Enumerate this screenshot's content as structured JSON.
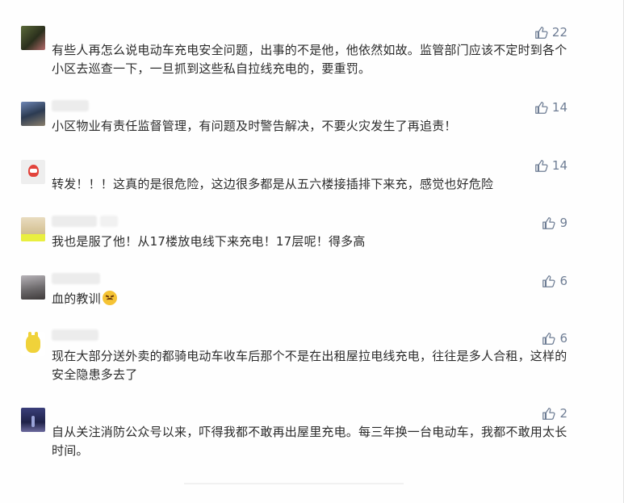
{
  "comments": [
    {
      "text": "有些人再怎么说电动车充电安全问题，出事的不是他，他依然如故。监管部门应该不定时到各个小区去巡查一下，一旦抓到这些私自拉线充电的，要重罚。",
      "likes": "22",
      "avatar_color": "#3b4a2e"
    },
    {
      "text": "小区物业有责任监督管理，有问题及时警告解决，不要火灾发生了再追责！",
      "likes": "14",
      "avatar_color": "#4a5a74"
    },
    {
      "text": "转发！！！这真的是很危险，这边很多都是从五六楼接插排下来充，感觉也好危险",
      "likes": "14",
      "avatar_color": "#e5e5e5"
    },
    {
      "text": "我也是服了他！从17楼放电线下来充电！17层呢！得多高",
      "likes": "9",
      "avatar_color": "#d8c89a"
    },
    {
      "text": "血的教训",
      "likes": "6",
      "avatar_color": "#6d6a6c"
    },
    {
      "text": "现在大部分送外卖的都骑电动车收车后那个不是在出租屋拉电线充电，往往是多人合租，这样的安全隐患多去了",
      "likes": "6",
      "avatar_color": "#f0d23a"
    },
    {
      "text": "自从关注消防公众号以来，吓得我都不敢再出屋里充电。每三年换一台电动车，我都不敢用太长时间。",
      "likes": "2",
      "avatar_color": "#2a2f5a"
    }
  ],
  "icons": {
    "like": "thumbs-up-icon",
    "emoji": "angry-face-emoji"
  },
  "colors": {
    "like_text": "#6e7d94",
    "comment_text": "#2b2b2b"
  }
}
